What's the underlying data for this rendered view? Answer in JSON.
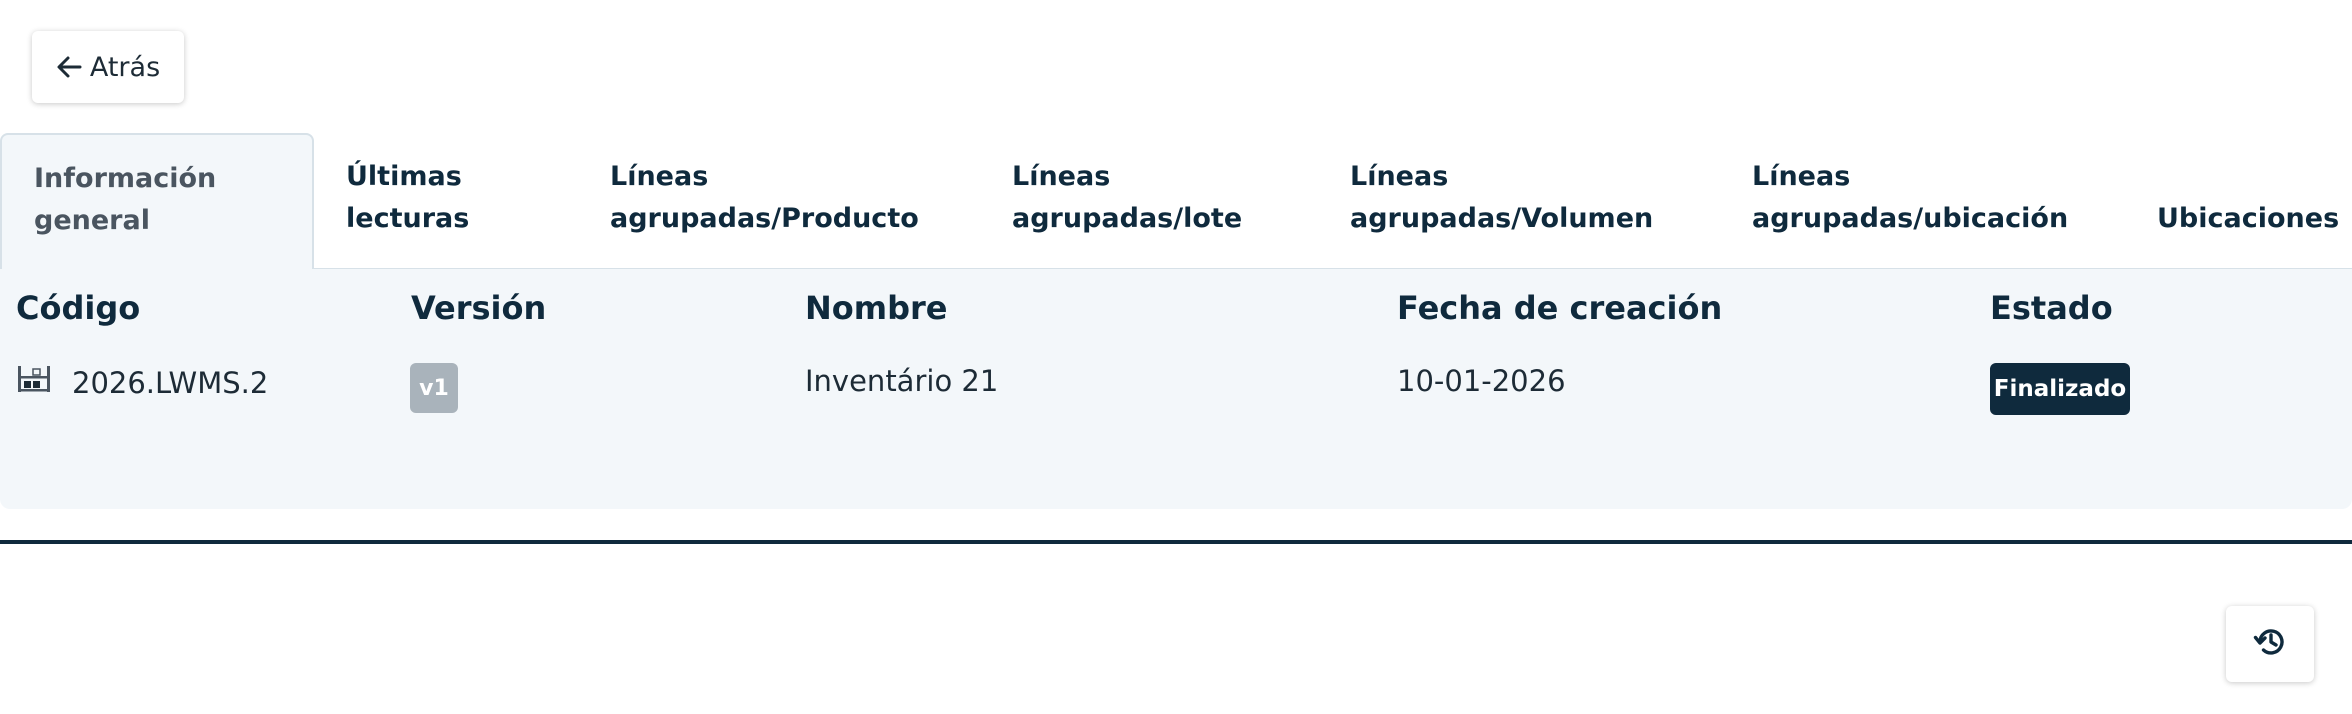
{
  "back_button": {
    "label": "Atrás",
    "icon": "arrow-left-icon"
  },
  "tabs": [
    {
      "line1": "Información",
      "line2": "general",
      "active": true
    },
    {
      "line1": "Últimas",
      "line2": "lecturas",
      "active": false
    },
    {
      "line1": "Líneas",
      "line2": "agrupadas/Producto",
      "active": false
    },
    {
      "line1": "Líneas",
      "line2": "agrupadas/lote",
      "active": false
    },
    {
      "line1": "Líneas",
      "line2": "agrupadas/Volumen",
      "active": false
    },
    {
      "line1": "Líneas",
      "line2": "agrupadas/ubicación",
      "active": false
    },
    {
      "line1": "",
      "line2": "Ubicaciones",
      "active": false
    }
  ],
  "table": {
    "headers": {
      "code": "Código",
      "version": "Versión",
      "name": "Nombre",
      "created": "Fecha de creación",
      "status": "Estado"
    },
    "row": {
      "code_icon": "inventory-shelf-icon",
      "code": "2026.LWMS.2",
      "version": "v1",
      "name": "Inventário 21",
      "created": "10-01-2026",
      "status": "Finalizado"
    }
  },
  "history_button": {
    "icon": "history-icon"
  },
  "colors": {
    "primary": "#0f2a3d",
    "panel_bg": "#f3f7fa",
    "tab_border": "#d7e1e8",
    "version_badge": "#a9b3bb"
  }
}
